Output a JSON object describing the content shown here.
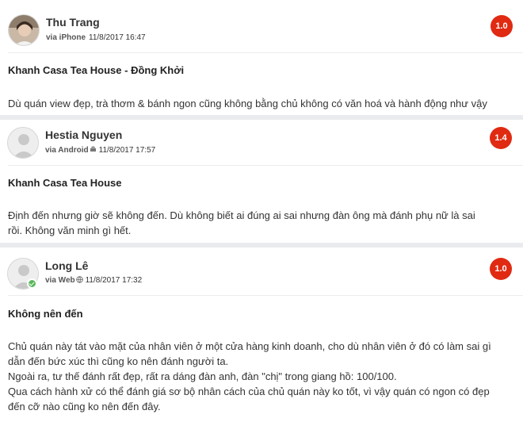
{
  "reviews": [
    {
      "user_name": "Thu Trang",
      "via": "via iPhone",
      "device_icon": "apple-icon",
      "datetime": "11/8/2017 16:47",
      "score": "1.0",
      "score_color": "#e02a12",
      "title": "Khanh Casa Tea House - Đồng Khởi",
      "lines": [
        "Dù quán view đẹp, trà thơm & bánh ngon cũng không bằng chủ không có văn hoá và hành động như vậy"
      ]
    },
    {
      "user_name": "Hestia Nguyen",
      "via": "via Android",
      "device_icon": "android-icon",
      "datetime": "11/8/2017 17:57",
      "score": "1.4",
      "score_color": "#e02a12",
      "title": "Khanh Casa Tea House",
      "lines": [
        "Định đến nhưng giờ sẽ không đến. Dù không biết ai đúng ai sai nhưng đàn ông mà đánh phụ nữ là sai",
        "rồi. Không văn minh gì hết."
      ]
    },
    {
      "user_name": "Long Lê",
      "via": "via Web",
      "device_icon": "globe-icon",
      "datetime": "11/8/2017 17:32",
      "score": "1.0",
      "score_color": "#e02a12",
      "title": "Không nên đến",
      "lines": [
        "Chủ quán này tát vào mặt của nhân viên ở một cửa hàng kinh doanh, cho dù nhân viên ở đó có làm sai gì",
        "dẫn đến bức xúc thì cũng ko nên đánh người ta.",
        "Ngoài ra, tư thế đánh rất đẹp, rất ra dáng đàn anh, đàn \"chị\" trong giang hồ: 100/100.",
        "Qua cách hành xử có thể đánh giá sơ bộ nhân cách của chủ quán này ko tốt, vì vậy quán có ngon có đẹp",
        "đến cỡ nào cũng ko nên đến đây."
      ]
    }
  ]
}
